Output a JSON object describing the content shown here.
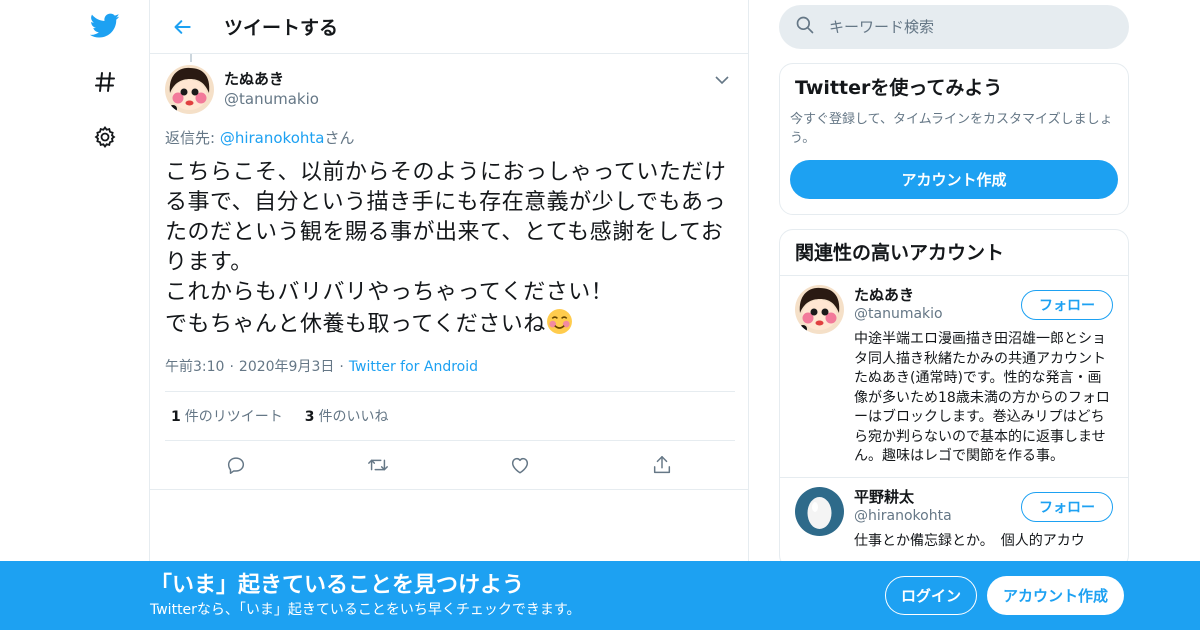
{
  "header": {
    "title": "ツイートする"
  },
  "tweet": {
    "author_name": "たぬあき",
    "author_handle": "@tanumakio",
    "reply_prefix": "返信先: ",
    "reply_mention": "@hiranokohta",
    "reply_suffix": "さん",
    "text": "こちらこそ、以前からそのようにおっしゃっていただける事で、自分という描き手にも存在意義が少しでもあったのだという観を賜る事が出来て、とても感謝をしております。\nこれからもバリバリやっちゃってください！\nでもちゃんと休養も取ってくださいね",
    "emoji": "smiling-face-with-blush-icon",
    "time": "午前3:10",
    "date": "2020年9月3日",
    "source": "Twitter for Android",
    "retweet_count": "1",
    "retweet_label": "件のリツイート",
    "like_count": "3",
    "like_label": "件のいいね"
  },
  "search": {
    "placeholder": "キーワード検索"
  },
  "signup_card": {
    "title": "Twitterを使ってみよう",
    "desc": "今すぐ登録して、タイムラインをカスタマイズしましょう。",
    "button": "アカウント作成"
  },
  "related": {
    "title": "関連性の高いアカウント",
    "accounts": [
      {
        "name": "たぬあき",
        "handle": "@tanumakio",
        "follow": "フォロー",
        "bio": "中途半端エロ漫画描き田沼雄一郎とショタ同人描き秋緒たかみの共通アカウントたぬあき(通常時)です。性的な発言・画像が多いため18歳未満の方からのフォローはブロックします。巻込みリプはどちら宛か判らないので基本的に返事しません。趣味はレゴで関節を作る事。"
      },
      {
        "name": "平野耕太",
        "handle": "@hiranokohta",
        "follow": "フォロー",
        "bio": "仕事とか備忘録とか。　個人的アカウ"
      }
    ]
  },
  "banner": {
    "title": "「いま」起きていることを見つけよう",
    "subtitle": "Twitterなら、「いま」起きていることをいち早くチェックできます。",
    "login": "ログイン",
    "signup": "アカウント作成"
  },
  "colors": {
    "accent": "#1da1f2",
    "muted": "#657786",
    "border": "#e6ecf0"
  }
}
